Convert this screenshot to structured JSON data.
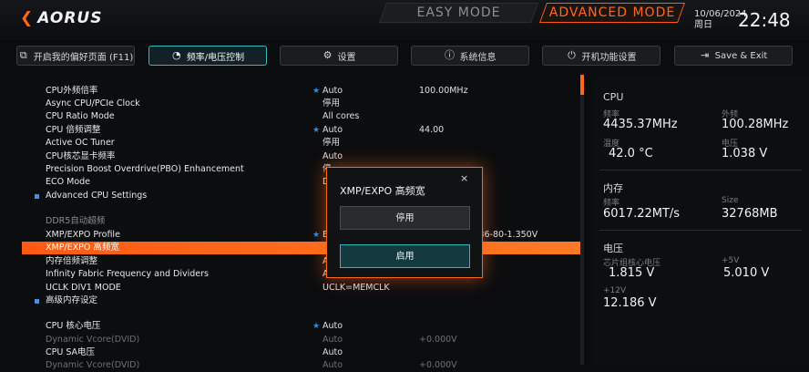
{
  "header": {
    "logo": "AORUS",
    "easy_mode": "EASY MODE",
    "advanced_mode": "ADVANCED MODE",
    "date": "10/06/2024",
    "weekday": "周日",
    "time": "22:48"
  },
  "nav": [
    {
      "label": "开启我的偏好页面 (F11)",
      "icon": "favorite-page-icon"
    },
    {
      "label": "频率/电压控制",
      "icon": "speedometer-icon"
    },
    {
      "label": "设置",
      "icon": "gear-icon"
    },
    {
      "label": "系统信息",
      "icon": "info-icon"
    },
    {
      "label": "开机功能设置",
      "icon": "power-icon"
    },
    {
      "label": "Save & Exit",
      "icon": "exit-icon"
    }
  ],
  "settings": [
    {
      "label": "CPU外频倍率",
      "value": "Auto",
      "value2": "100.00MHz"
    },
    {
      "label": "Async CPU/PCIe Clock",
      "value": "停用",
      "value2": ""
    },
    {
      "label": "CPU Ratio Mode",
      "value": "All cores",
      "value2": ""
    },
    {
      "label": "CPU 倍频调整",
      "value": "Auto",
      "value2": "44.00"
    },
    {
      "label": "Active OC Tuner",
      "value": "停用",
      "value2": ""
    },
    {
      "label": "CPU核芯显卡频率",
      "value": "Auto",
      "value2": ""
    },
    {
      "label": "Precision Boost Overdrive(PBO) Enhancement",
      "value": "停",
      "value2": ""
    },
    {
      "label": "ECO Mode",
      "value": "D",
      "value2": ""
    },
    {
      "label": "Advanced CPU Settings",
      "value": "",
      "value2": ""
    },
    {
      "label": "DDR5自动超频",
      "value": "",
      "value2": ""
    },
    {
      "label": "XMP/EXPO Profile",
      "value": "E",
      "value2": "6-36-80-1.350V"
    },
    {
      "label": "XMP/EXPO 高频宽",
      "value": "",
      "value2": ""
    },
    {
      "label": "内存倍频调整",
      "value": "A",
      "value2": ""
    },
    {
      "label": "Infinity Fabric Frequency and Dividers",
      "value": "A",
      "value2": ""
    },
    {
      "label": "UCLK DIV1 MODE",
      "value": "UCLK=MEMCLK",
      "value2": ""
    },
    {
      "label": "高级内存设定",
      "value": "",
      "value2": ""
    },
    {
      "label": "CPU 核心电压",
      "value": "Auto",
      "value2": ""
    },
    {
      "label": "Dynamic Vcore(DVID)",
      "value": "Auto",
      "value2": "+0.000V"
    },
    {
      "label": "CPU SA电压",
      "value": "Auto",
      "value2": ""
    },
    {
      "label": "Dynamic Vcore(DVID)",
      "value": "Auto",
      "value2": "+0.000V"
    }
  ],
  "dialog": {
    "title": "XMP/EXPO 高频宽",
    "close": "×",
    "option_disable": "停用",
    "option_enable": "启用"
  },
  "sysinfo": {
    "cpu_title": "CPU",
    "freq_label": "频率",
    "freq_value": "4435.37MHz",
    "bclk_label": "外频",
    "bclk_value": "100.28MHz",
    "temp_label": "温度",
    "temp_value": "42.0 °C",
    "volt_label": "电压",
    "volt_value": "1.038 V",
    "mem_title": "内存",
    "mem_freq_label": "频率",
    "mem_freq_value": "6017.22MT/s",
    "size_label": "Size",
    "size_value": "32768MB",
    "voltage_title": "电压",
    "chipset_label": "芯片组核心电压",
    "chipset_value": "1.815 V",
    "v5_label": "+5V",
    "v5_value": "5.010 V",
    "v12_label": "+12V",
    "v12_value": "12.186 V"
  },
  "colors": {
    "accent": "#ff6a1a",
    "active_tab": "#2fb7c6",
    "info_star": "#2d8ee0"
  }
}
